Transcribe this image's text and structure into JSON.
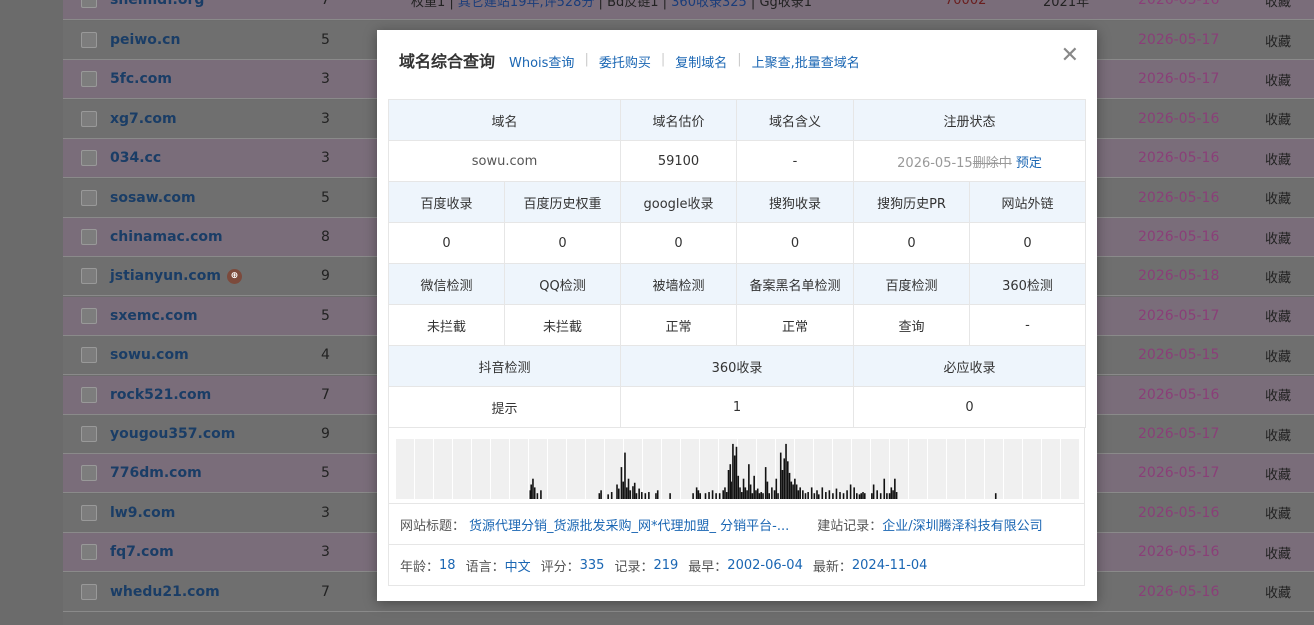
{
  "background": {
    "top_row": {
      "domain": "shelmdf.org",
      "num": "7",
      "segments": [
        {
          "text": "权重1 | ",
          "cls": ""
        },
        {
          "text": "其它建站19年,评528分",
          "cls": "b"
        },
        {
          "text": " | Bd反链1 | ",
          "cls": ""
        },
        {
          "text": "360收录325",
          "cls": "b"
        },
        {
          "text": " | Gg收录1",
          "cls": ""
        }
      ],
      "price": "70002",
      "year": "2021年",
      "date": "2026-05-16",
      "fav": "收藏"
    },
    "rows": [
      {
        "domain": "peiwo.cn",
        "num": "5",
        "date": "2026-05-17",
        "fav": "收藏"
      },
      {
        "domain": "5fc.com",
        "num": "3",
        "date": "2026-05-17",
        "fav": "收藏"
      },
      {
        "domain": "xg7.com",
        "num": "3",
        "date": "2026-05-16",
        "fav": "收藏"
      },
      {
        "domain": "034.cc",
        "num": "3",
        "date": "2026-05-16",
        "fav": "收藏"
      },
      {
        "domain": "sosaw.com",
        "num": "5",
        "date": "2026-05-16",
        "fav": "收藏"
      },
      {
        "domain": "chinamac.com",
        "num": "8",
        "date": "2026-05-16",
        "fav": "收藏"
      },
      {
        "domain": "jstianyun.com",
        "num": "9",
        "date": "2026-05-18",
        "fav": "收藏",
        "badge": "⊕"
      },
      {
        "domain": "sxemc.com",
        "num": "5",
        "date": "2026-05-17",
        "fav": "收藏"
      },
      {
        "domain": "sowu.com",
        "num": "4",
        "date": "2026-05-15",
        "fav": "收藏"
      },
      {
        "domain": "rock521.com",
        "num": "7",
        "date": "2026-05-16",
        "fav": "收藏"
      },
      {
        "domain": "yougou357.com",
        "num": "9",
        "date": "2026-05-17",
        "fav": "收藏"
      },
      {
        "domain": "776dm.com",
        "num": "5",
        "date": "2026-05-17",
        "fav": "收藏"
      },
      {
        "domain": "lw9.com",
        "num": "3",
        "date": "2026-05-16",
        "fav": "收藏"
      },
      {
        "domain": "fq7.com",
        "num": "3",
        "date": "2026-05-16",
        "fav": "收藏"
      },
      {
        "domain": "whedu21.com",
        "num": "7",
        "date": "2026-05-16",
        "fav": "收藏"
      }
    ]
  },
  "modal": {
    "title": "域名综合查询",
    "links": [
      "Whois查询",
      "委托购买",
      "复制域名",
      "上聚查,批量查域名"
    ],
    "close": "✕",
    "table": {
      "h1": [
        "域名",
        "域名估价",
        "域名含义",
        "注册状态"
      ],
      "r1": {
        "domain": "sowu.com",
        "price": "59100",
        "meaning": "-",
        "status_date": "2026-05-15",
        "status_text": "删除中",
        "reserve": "预定"
      },
      "h2": [
        "百度收录",
        "百度历史权重",
        "google收录",
        "搜狗收录",
        "搜狗历史PR",
        "网站外链"
      ],
      "r2": [
        "0",
        "0",
        "0",
        "0",
        "0",
        "0"
      ],
      "h3": [
        "微信检测",
        "QQ检测",
        "被墙检测",
        "备案黑名单检测",
        "百度检测",
        "360检测"
      ],
      "r3": [
        "未拦截",
        "未拦截",
        "正常",
        "正常",
        "查询",
        "-"
      ],
      "h4": [
        "抖音检测",
        "360收录",
        "必应收录"
      ],
      "r4": [
        "提示",
        "1",
        "0"
      ]
    },
    "history": {
      "title_label": "网站标题：",
      "title_value": "货源代理分销_货源批发采购_网*代理加盟_ 分销平台-...",
      "record_label": "建站记录：",
      "record_value": "企业/深圳腾泽科技有限公司",
      "age_label": "年龄：",
      "age": "18",
      "lang_label": "语言：",
      "lang": "中文",
      "score_label": "评分：",
      "score": "335",
      "rec_label": "记录：",
      "rec": "219",
      "earliest_label": "最早：",
      "earliest": "2002-06-04",
      "latest_label": "最新：",
      "latest": "2024-11-04"
    },
    "chart_data": {
      "type": "bar",
      "values": [
        0,
        0,
        0,
        0,
        0,
        0,
        0,
        0,
        0,
        0,
        0,
        0,
        0,
        0,
        0,
        0,
        0,
        0,
        0,
        0,
        0,
        0,
        0,
        0,
        0,
        0,
        0,
        0,
        0,
        0,
        0,
        0,
        0,
        0,
        0,
        0,
        0,
        0,
        0,
        0,
        0,
        0,
        0,
        0,
        0,
        0,
        0,
        0,
        0,
        0,
        0,
        0,
        0,
        0,
        0,
        0,
        0,
        0,
        0,
        0,
        0,
        0,
        0,
        0,
        0,
        0,
        0,
        0,
        0,
        0,
        0,
        0,
        0,
        0,
        0,
        0,
        0,
        0,
        0,
        0,
        0,
        0,
        0,
        0,
        0,
        0,
        0,
        0,
        0,
        0,
        0,
        0,
        0,
        0,
        0,
        0,
        0,
        0,
        0,
        0,
        0,
        0,
        0,
        0,
        0,
        0,
        0,
        0,
        0,
        0,
        0,
        0,
        0,
        0,
        0,
        0,
        0,
        0,
        0,
        0,
        0,
        0,
        0,
        0,
        0,
        0,
        0,
        0,
        0,
        0,
        0,
        0,
        0,
        0,
        0,
        0,
        0,
        0,
        0,
        0,
        0,
        0,
        0,
        0,
        0,
        0,
        0,
        0,
        0,
        0,
        0,
        0,
        0,
        0,
        0,
        0,
        0,
        0,
        0,
        0,
        0,
        0,
        0,
        0,
        0,
        0,
        0,
        0,
        0,
        0,
        0,
        0,
        0,
        0,
        0,
        0,
        0,
        0,
        0,
        0,
        0,
        0,
        0,
        0,
        0,
        0,
        0,
        0,
        0,
        0,
        0,
        0,
        0,
        0,
        0,
        0,
        0,
        0,
        0,
        0,
        0,
        0,
        0,
        0,
        0,
        0,
        0,
        0,
        0,
        0,
        0,
        0,
        0,
        0,
        0,
        0,
        0,
        0,
        0,
        0,
        0,
        0,
        0,
        0,
        0,
        0,
        0,
        0,
        0,
        0,
        0,
        0,
        0,
        0,
        0,
        0,
        0,
        0,
        0,
        0,
        0,
        0,
        0,
        0,
        0,
        0,
        0,
        0,
        0,
        0,
        0,
        0,
        0,
        0,
        0,
        0,
        0,
        0,
        0,
        0,
        0,
        0,
        0,
        0,
        0,
        0,
        0,
        0,
        0,
        0,
        0,
        0,
        0,
        0,
        0,
        0,
        0,
        0,
        0,
        0,
        0,
        0,
        0,
        0,
        0,
        0,
        0,
        0,
        0,
        0,
        0,
        0,
        0,
        0,
        0,
        0,
        0,
        0,
        0,
        0,
        0,
        0,
        0,
        0,
        0,
        0,
        0,
        0,
        0,
        0,
        0,
        0,
        0,
        0,
        0,
        0,
        0,
        0,
        0,
        0,
        0,
        0,
        0,
        0,
        0,
        0,
        0,
        0,
        0,
        0,
        0,
        0,
        0,
        0,
        0,
        0,
        0,
        0,
        0,
        0,
        0,
        0,
        0,
        0,
        0,
        0,
        0,
        0,
        0,
        0,
        0,
        0,
        0,
        0,
        0,
        0,
        0,
        0,
        0,
        0,
        0,
        0,
        0,
        0,
        0,
        0,
        0,
        0,
        0,
        0,
        0,
        0,
        0,
        0,
        0,
        0,
        0,
        0,
        0,
        0,
        0,
        0,
        0,
        0,
        0,
        0,
        0,
        0,
        0,
        0,
        0,
        0,
        0,
        0,
        0,
        0,
        0,
        0,
        0,
        0,
        0,
        0,
        0,
        0,
        0,
        0,
        0,
        0,
        0,
        0,
        0,
        0,
        0,
        0,
        0,
        0,
        0,
        0,
        0,
        0,
        0,
        0,
        0,
        0,
        0,
        0,
        0,
        0,
        0,
        0,
        0,
        0,
        0,
        0,
        0,
        0,
        0,
        0,
        0,
        0,
        0,
        0,
        0,
        0,
        0,
        0,
        0,
        0,
        0,
        0,
        0,
        0,
        0,
        0,
        0,
        0,
        0,
        0,
        0,
        0,
        0,
        0,
        0,
        0,
        0,
        0,
        0,
        0,
        0,
        0,
        0,
        0,
        0,
        0,
        0,
        0,
        0,
        0,
        0,
        0,
        0,
        0,
        0,
        0,
        0,
        0,
        0,
        0,
        0,
        0,
        0,
        0,
        0,
        0,
        0,
        0,
        0,
        0,
        0,
        0,
        0,
        0,
        0,
        0,
        0,
        0,
        0,
        0,
        0,
        0,
        0,
        0,
        0,
        0,
        0,
        0,
        0,
        0,
        0,
        0,
        0,
        0,
        0,
        0,
        0,
        0,
        0,
        0,
        0,
        0,
        0,
        0,
        0,
        0,
        0,
        0,
        0,
        0,
        0,
        0,
        0,
        0,
        0,
        0,
        0,
        0,
        0,
        0,
        0,
        0,
        0,
        0,
        0,
        0,
        0,
        0,
        0,
        0,
        0,
        0,
        0,
        0,
        0,
        0,
        0,
        0,
        0,
        0,
        0,
        0,
        0,
        0,
        0,
        0,
        0,
        0,
        0,
        0,
        0,
        0,
        0,
        0,
        0,
        0,
        0,
        0,
        0,
        0,
        0,
        0,
        0,
        0,
        0,
        0,
        0,
        0,
        0,
        0,
        0,
        0,
        0,
        0,
        0,
        0,
        0,
        0,
        0,
        0,
        0,
        0,
        0,
        0,
        0,
        0,
        0,
        0,
        0,
        0,
        0,
        0,
        0,
        0,
        0,
        0,
        0,
        0,
        0,
        0,
        0,
        0,
        0,
        0,
        0,
        0,
        0,
        0,
        0,
        0,
        0,
        0,
        0,
        0,
        0,
        0,
        0,
        0,
        0,
        0,
        0,
        0,
        0,
        0,
        0,
        0,
        0,
        0,
        0,
        0,
        0,
        0,
        0,
        0,
        0,
        0,
        0,
        0,
        0,
        0,
        0,
        0,
        0,
        0,
        0,
        0,
        0,
        0,
        0,
        0,
        0,
        0,
        0,
        0,
        0,
        0,
        0,
        0,
        0,
        0,
        0,
        0,
        0,
        0,
        0,
        0,
        0,
        0,
        0,
        0,
        0,
        0,
        0,
        0,
        0,
        0,
        0,
        0,
        0,
        0,
        0,
        0,
        0,
        0,
        0,
        0,
        0,
        0,
        0,
        0,
        0,
        0,
        0,
        0,
        0,
        0,
        0,
        0,
        0,
        0,
        0,
        0,
        0,
        0,
        0,
        0,
        0,
        0,
        0,
        0,
        0,
        0,
        0,
        0,
        0,
        0,
        0,
        0,
        0,
        0,
        0,
        0,
        0,
        0,
        0,
        0,
        0,
        0,
        0,
        0,
        0,
        0,
        0,
        0,
        0,
        0,
        0,
        0,
        0,
        0,
        0,
        0,
        0,
        0,
        0
      ],
      "ylim": [
        0,
        1
      ]
    }
  }
}
